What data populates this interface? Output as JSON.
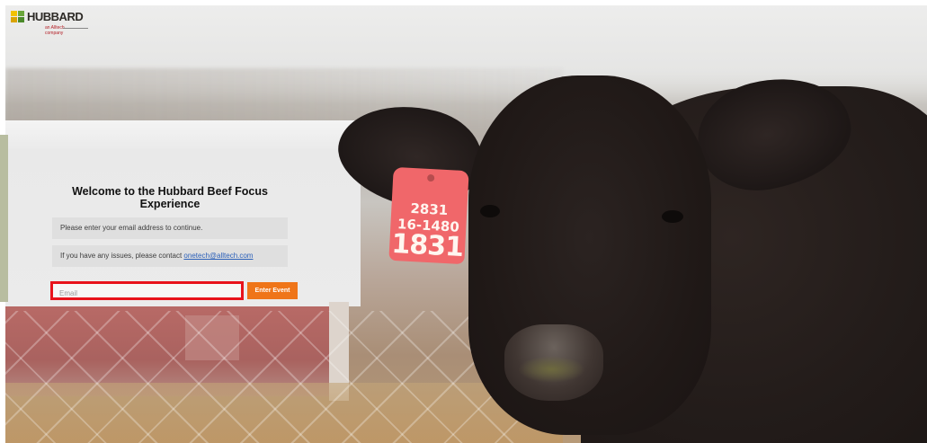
{
  "brand": {
    "logo_text": "HUBBARD",
    "logo_subtext": "an Alltech company",
    "logo_colors": [
      "#f2c200",
      "#6aa63a",
      "#d9a400",
      "#4b8a2a"
    ],
    "logo_icon": "hubbard-logo-icon"
  },
  "welcome": {
    "title_line1": "Welcome to the Hubbard Beef Focus",
    "title_line2": "Experience"
  },
  "info": {
    "instruction": "Please enter your email address to continue.",
    "issues_prefix": "If you have any issues, please contact ",
    "contact_email": "onetech@alltech.com"
  },
  "form": {
    "email_placeholder": "Email",
    "email_value": "",
    "submit_label": "Enter Event",
    "highlight_color": "#e8131c",
    "button_color": "#ef7519"
  },
  "background": {
    "ear_tag_line1": "2831",
    "ear_tag_line2": "16-1480",
    "ear_tag_line3": "1831",
    "ear_tag_color": "#f0676a"
  }
}
